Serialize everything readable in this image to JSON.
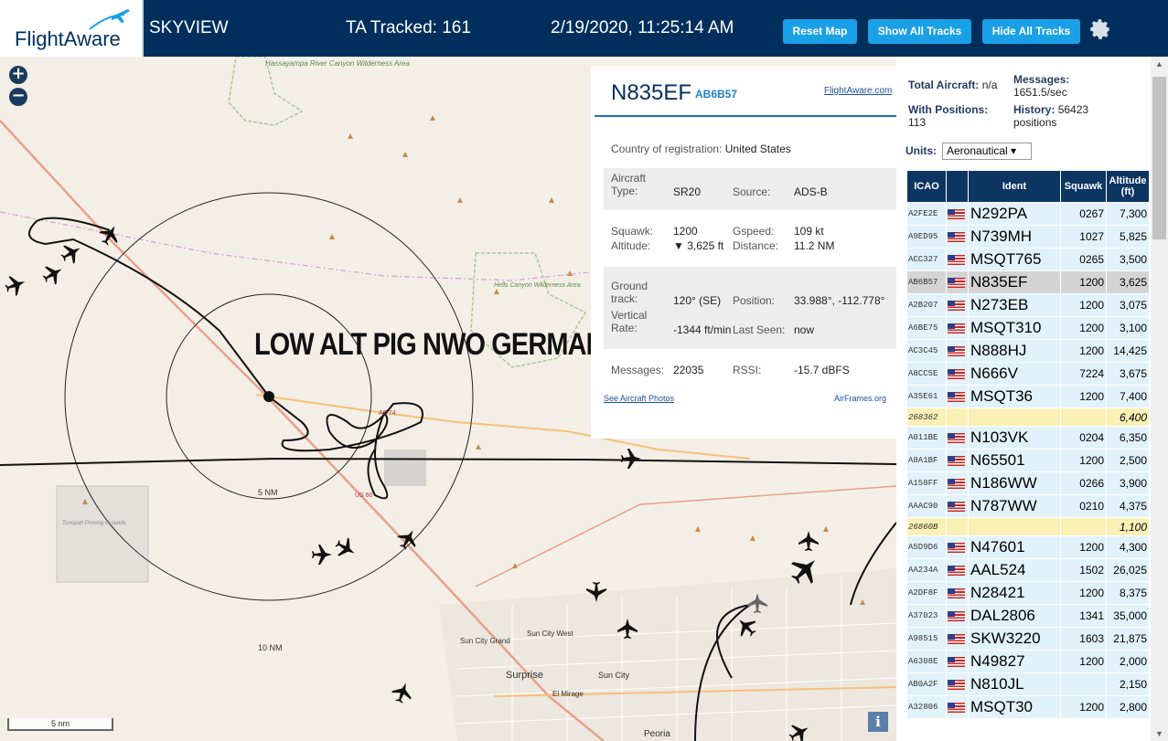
{
  "header": {
    "logo_text": "FlightAware",
    "app_name": "SKYVIEW",
    "tracked": "TA Tracked: 161",
    "datetime": "2/19/2020, 11:25:14 AM",
    "buttons": {
      "reset": "Reset Map",
      "show_all": "Show All Tracks",
      "hide_all": "Hide All Tracks"
    },
    "settings_icon": "gear-icon"
  },
  "map": {
    "zoom_in": "+",
    "zoom_out": "−",
    "overlay_text": "LOW ALT PIG NWO GERMANS",
    "ring_labels": [
      "5 NM",
      "10 NM"
    ],
    "place_labels": [
      "Hassayampa River Canyon Wilderness Area",
      "Hells Canyon Wilderness Area",
      "Sun City Grand",
      "Sun City West",
      "Surprise",
      "Sun City",
      "El Mirage",
      "Peoria",
      "Tonopah Proving Grounds"
    ],
    "road_labels": [
      "US 60",
      "AZ 74"
    ],
    "scale_label": "5 nm",
    "info_icon": "i"
  },
  "popup": {
    "registration": "N835EF",
    "icao": "AB6B57",
    "link": "FlightAware.com",
    "country_label": "Country of registration:",
    "country": "United States",
    "aircraft_type_label": "Aircraft Type:",
    "aircraft_type": "SR20",
    "source_label": "Source:",
    "source": "ADS-B",
    "squawk_label": "Squawk:",
    "squawk": "1200",
    "altitude_label": "Altitude:",
    "altitude": "▼ 3,625 ft",
    "gspeed_label": "Gspeed:",
    "gspeed": "109 kt",
    "distance_label": "Distance:",
    "distance": "11.2 NM",
    "ground_track_label": "Ground track:",
    "ground_track": "120° (SE)",
    "position_label": "Position:",
    "position": "33.988°, -112.778°",
    "vrate_label": "Vertical Rate:",
    "vrate": "-1344 ft/min",
    "last_seen_label": "Last Seen:",
    "last_seen": "now",
    "messages_label": "Messages:",
    "messages": "22035",
    "rssi_label": "RSSI:",
    "rssi": "-15.7 dBFS",
    "photos_link": "See Aircraft Photos",
    "airframes_link": "AirFrames.org"
  },
  "sidebar": {
    "total_label": "Total Aircraft:",
    "total": "n/a",
    "messages_label": "Messages:",
    "messages": "1651.5/sec",
    "positions_label": "With Positions:",
    "positions": "113",
    "history_label": "History:",
    "history": "56423 positions",
    "units_label": "Units:",
    "units_value": "Aeronautical ▾",
    "columns": [
      "ICAO",
      "",
      "Ident",
      "Squawk",
      "Altitude (ft)"
    ],
    "rows": [
      {
        "icao": "A2FE2E",
        "flag": true,
        "ident": "N292PA",
        "squawk": "0267",
        "alt": "7,300"
      },
      {
        "icao": "A9ED95",
        "flag": true,
        "ident": "N739MH",
        "squawk": "1027",
        "alt": "5,825"
      },
      {
        "icao": "ACC327",
        "flag": true,
        "ident": "MSQT765",
        "squawk": "0265",
        "alt": "3,500"
      },
      {
        "icao": "AB6B57",
        "flag": true,
        "ident": "N835EF",
        "squawk": "1200",
        "alt": "3,625",
        "selected": true
      },
      {
        "icao": "A2B207",
        "flag": true,
        "ident": "N273EB",
        "squawk": "1200",
        "alt": "3,075"
      },
      {
        "icao": "A6BE75",
        "flag": true,
        "ident": "MSQT310",
        "squawk": "1200",
        "alt": "3,100"
      },
      {
        "icao": "AC3C45",
        "flag": true,
        "ident": "N888HJ",
        "squawk": "1200",
        "alt": "14,425"
      },
      {
        "icao": "A8CC5E",
        "flag": true,
        "ident": "N666V",
        "squawk": "7224",
        "alt": "3,675"
      },
      {
        "icao": "A35E61",
        "flag": true,
        "ident": "MSQT36",
        "squawk": "1200",
        "alt": "7,400"
      },
      {
        "icao": "268362",
        "flag": false,
        "ident": "",
        "squawk": "",
        "alt": "6,400",
        "mlat": true
      },
      {
        "icao": "A011BE",
        "flag": true,
        "ident": "N103VK",
        "squawk": "0204",
        "alt": "6,350"
      },
      {
        "icao": "A8A1BF",
        "flag": true,
        "ident": "N65501",
        "squawk": "1200",
        "alt": "2,500"
      },
      {
        "icao": "A158FF",
        "flag": true,
        "ident": "N186WW",
        "squawk": "0266",
        "alt": "3,900"
      },
      {
        "icao": "AAAC90",
        "flag": true,
        "ident": "N787WW",
        "squawk": "0210",
        "alt": "4,375"
      },
      {
        "icao": "26860B",
        "flag": false,
        "ident": "",
        "squawk": "",
        "alt": "1,100",
        "mlat": true
      },
      {
        "icao": "A5D9D6",
        "flag": true,
        "ident": "N47601",
        "squawk": "1200",
        "alt": "4,300"
      },
      {
        "icao": "AA234A",
        "flag": true,
        "ident": "AAL524",
        "squawk": "1502",
        "alt": "26,025"
      },
      {
        "icao": "A2DF8F",
        "flag": true,
        "ident": "N28421",
        "squawk": "1200",
        "alt": "8,375"
      },
      {
        "icao": "A37023",
        "flag": true,
        "ident": "DAL2806",
        "squawk": "1341",
        "alt": "35,000"
      },
      {
        "icao": "A98515",
        "flag": true,
        "ident": "SKW3220",
        "squawk": "1603",
        "alt": "21,875"
      },
      {
        "icao": "A6308E",
        "flag": true,
        "ident": "N49827",
        "squawk": "1200",
        "alt": "2,000"
      },
      {
        "icao": "AB0A2F",
        "flag": true,
        "ident": "N810JL",
        "squawk": "",
        "alt": "2,150"
      },
      {
        "icao": "A32806",
        "flag": true,
        "ident": "MSQT30",
        "squawk": "1200",
        "alt": "2,800"
      }
    ]
  }
}
